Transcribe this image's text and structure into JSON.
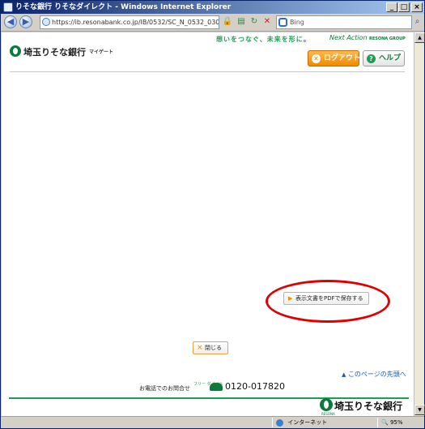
{
  "window": {
    "title": "りそな銀行  りそなダイレクト - Windows Internet Explorer",
    "minimize": "_",
    "maximize": "□",
    "close": "×"
  },
  "addressbar": {
    "url": "https://ib.resonabank.co.jp/IB/0532/SC_N_0532_030.aspx?r=0.7",
    "search_value": "Bing"
  },
  "header": {
    "logo_text": "埼玉りそな銀行",
    "logo_sub": "マイゲート",
    "slogan": "想いをつなぐ、未来を形に。",
    "slogan_script": "Next Action",
    "group": "RESONA GROUP",
    "logout_label": "ログアウト",
    "help_label": "ヘルプ"
  },
  "main": {
    "pdf_label": "表示文書をPDFで保存する",
    "close_label": "閉じる",
    "page_top": "このページの先頭へ"
  },
  "footer": {
    "contact_label": "お電話でのお問合せ",
    "free_dial": "フリー ダイヤル",
    "phone": "0120-017820",
    "logo_text": "埼玉りそな銀行",
    "logo_sub": "RESONA"
  },
  "statusbar": {
    "zone": "インターネット",
    "zoom": "95%"
  },
  "colors": {
    "brand_green": "#0b7a3b",
    "accent_orange": "#f08a00",
    "annotation_red": "#e00000"
  }
}
